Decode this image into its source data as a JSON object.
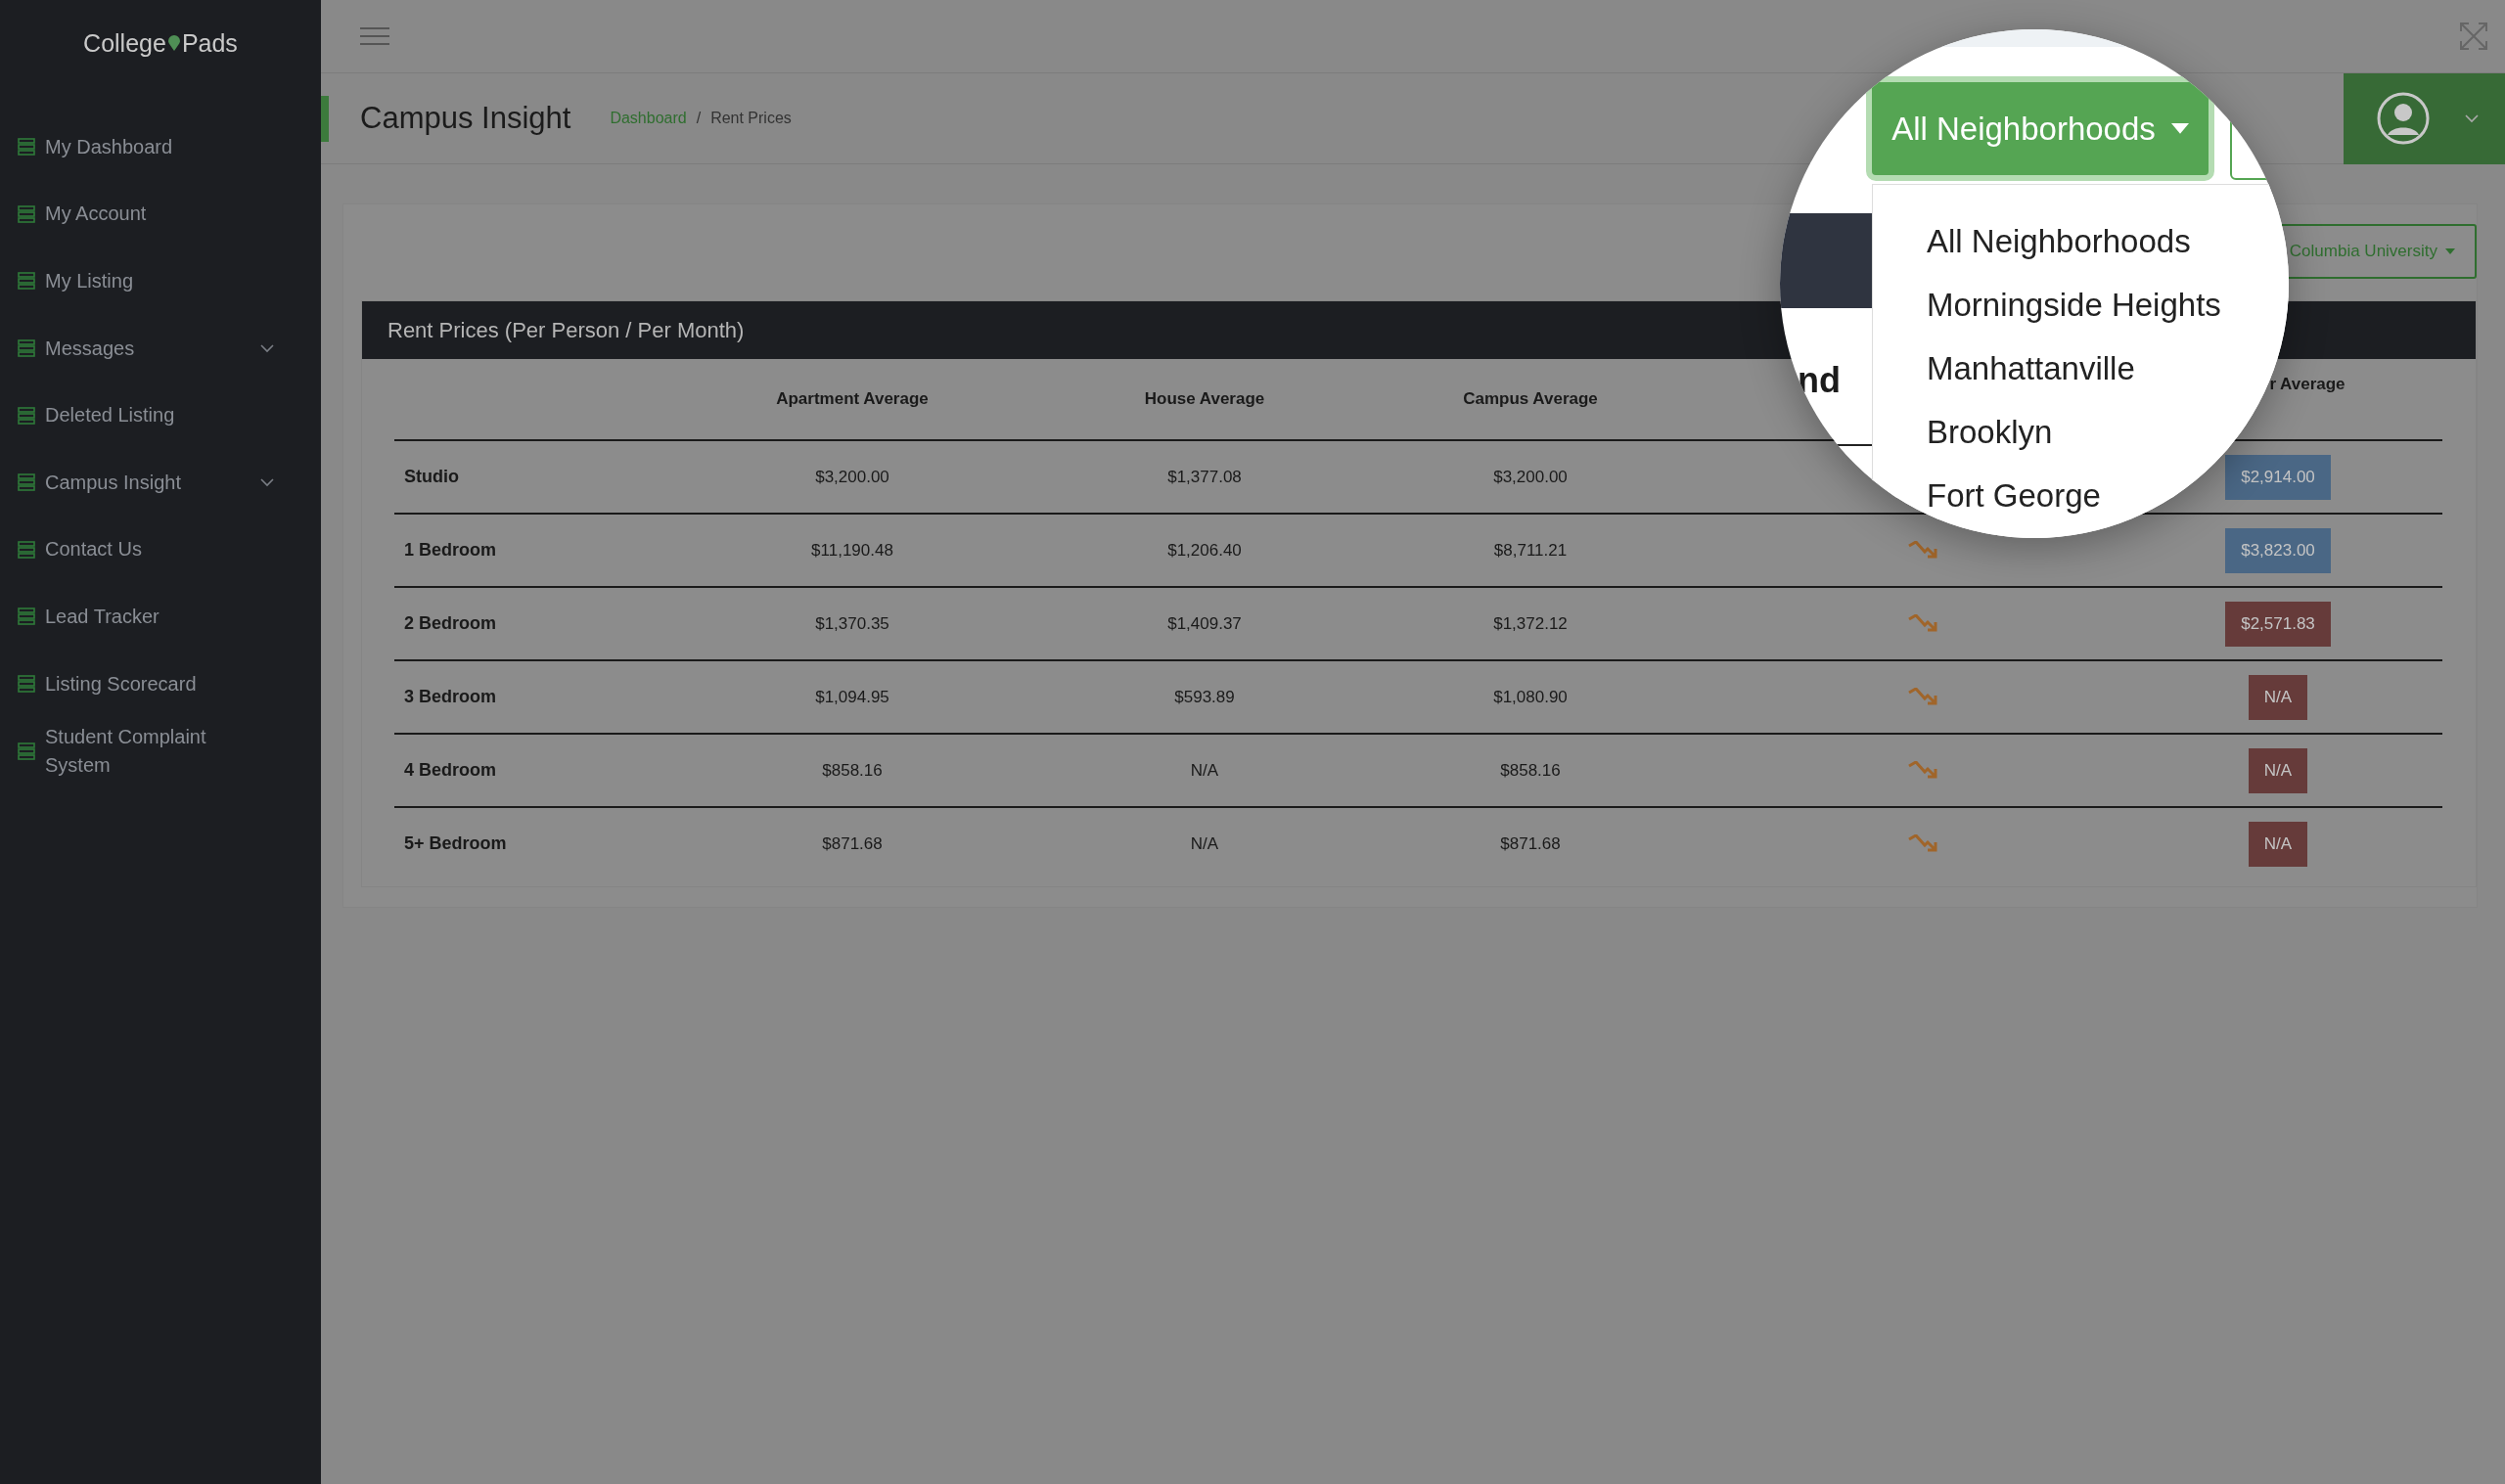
{
  "sidebar": {
    "logo": [
      "College",
      "Pads"
    ],
    "items": [
      {
        "label": "My Dashboard",
        "submenu": false
      },
      {
        "label": "My Account",
        "submenu": false
      },
      {
        "label": "My Listing",
        "submenu": false
      },
      {
        "label": "Messages",
        "submenu": true
      },
      {
        "label": "Deleted Listing",
        "submenu": false
      },
      {
        "label": "Campus Insight",
        "submenu": true
      },
      {
        "label": "Contact Us",
        "submenu": false
      },
      {
        "label": "Lead Tracker",
        "submenu": false
      },
      {
        "label": "Listing Scorecard",
        "submenu": false
      },
      {
        "label": "Student Complaint System",
        "submenu": false
      }
    ]
  },
  "page": {
    "title": "Campus Insight",
    "breadcrumb": [
      {
        "label": "Dashboard",
        "link": true
      },
      {
        "label": "Rent Prices",
        "link": false
      }
    ],
    "separator": "/"
  },
  "university_dropdown": {
    "label": "Columbia University"
  },
  "table": {
    "title": "Rent Prices (Per Person / Per Month)",
    "columns": [
      "Apartment Average",
      "House Average",
      "Campus Average",
      "r Average"
    ],
    "rows": [
      {
        "label": "Studio",
        "apartment": "$3,200.00",
        "house": "$1,377.08",
        "campus": "$3,200.00",
        "badge": {
          "text": "$2,914.00",
          "color": "#4a6785"
        }
      },
      {
        "label": "1 Bedroom",
        "apartment": "$11,190.48",
        "house": "$1,206.40",
        "campus": "$8,711.21",
        "trend_arrow": true,
        "badge": {
          "text": "$3,823.00",
          "color": "#4a6785"
        }
      },
      {
        "label": "2 Bedroom",
        "apartment": "$1,370.35",
        "house": "$1,409.37",
        "campus": "$1,372.12",
        "trend_arrow": true,
        "badge": {
          "text": "$2,571.83",
          "color": "#663b3a"
        }
      },
      {
        "label": "3 Bedroom",
        "apartment": "$1,094.95",
        "house": "$593.89",
        "campus": "$1,080.90",
        "trend_arrow": true,
        "badge": {
          "text": "N/A",
          "color": "#663b3a"
        }
      },
      {
        "label": "4 Bedroom",
        "apartment": "$858.16",
        "house": "N/A",
        "campus": "$858.16",
        "trend_arrow": true,
        "badge": {
          "text": "N/A",
          "color": "#663b3a"
        }
      },
      {
        "label": "5+ Bedroom",
        "apartment": "$871.68",
        "house": "N/A",
        "campus": "$871.68",
        "trend_arrow": true,
        "badge": {
          "text": "N/A",
          "color": "#663b3a"
        }
      }
    ]
  },
  "magnifier": {
    "fragment": "nd",
    "button": {
      "label": "All Neighborhoods"
    },
    "menu": [
      "All Neighborhoods",
      "Morningside Heights",
      "Manhattanville",
      "Brooklyn",
      "Fort George"
    ]
  }
}
